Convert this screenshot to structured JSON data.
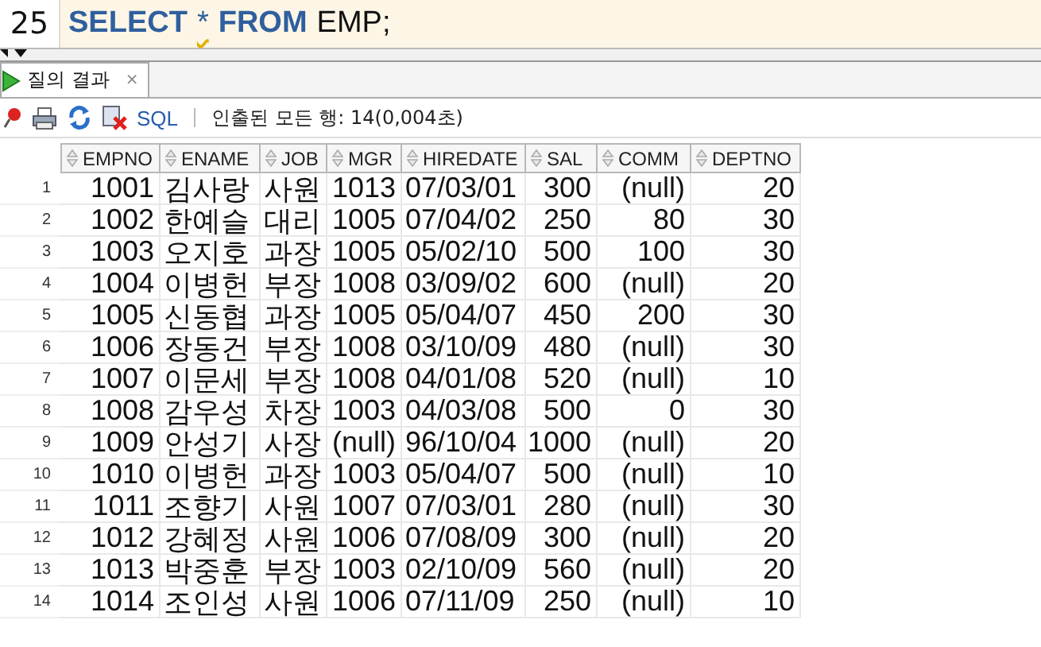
{
  "editor": {
    "line_number": "25",
    "tokens": [
      {
        "text": "SELECT",
        "kind": "keyword"
      },
      {
        "text": "*",
        "kind": "warning"
      },
      {
        "text": "FROM",
        "kind": "keyword"
      },
      {
        "text": "EMP;",
        "kind": "plain"
      }
    ]
  },
  "results_tab": {
    "label": "질의 결과",
    "close": "×",
    "selected": true
  },
  "toolbar": {
    "sql_link": "SQL",
    "status": "인출된 모든 행: 14(0,004초)"
  },
  "table": {
    "columns": [
      "EMPNO",
      "ENAME",
      "JOB",
      "MGR",
      "HIREDATE",
      "SAL",
      "COMM",
      "DEPTNO"
    ],
    "rows": [
      {
        "row_number": "1",
        "cells": [
          "1001",
          "김사랑",
          "사원",
          "1013",
          "07/03/01",
          "300",
          "(null)",
          "20"
        ]
      },
      {
        "row_number": "2",
        "cells": [
          "1002",
          "한예슬",
          "대리",
          "1005",
          "07/04/02",
          "250",
          "80",
          "30"
        ]
      },
      {
        "row_number": "3",
        "cells": [
          "1003",
          "오지호",
          "과장",
          "1005",
          "05/02/10",
          "500",
          "100",
          "30"
        ]
      },
      {
        "row_number": "4",
        "cells": [
          "1004",
          "이병헌",
          "부장",
          "1008",
          "03/09/02",
          "600",
          "(null)",
          "20"
        ]
      },
      {
        "row_number": "5",
        "cells": [
          "1005",
          "신동협",
          "과장",
          "1005",
          "05/04/07",
          "450",
          "200",
          "30"
        ]
      },
      {
        "row_number": "6",
        "cells": [
          "1006",
          "장동건",
          "부장",
          "1008",
          "03/10/09",
          "480",
          "(null)",
          "30"
        ]
      },
      {
        "row_number": "7",
        "cells": [
          "1007",
          "이문세",
          "부장",
          "1008",
          "04/01/08",
          "520",
          "(null)",
          "10"
        ]
      },
      {
        "row_number": "8",
        "cells": [
          "1008",
          "감우성",
          "차장",
          "1003",
          "04/03/08",
          "500",
          "0",
          "30"
        ]
      },
      {
        "row_number": "9",
        "cells": [
          "1009",
          "안성기",
          "사장",
          "(null)",
          "96/10/04",
          "1000",
          "(null)",
          "20"
        ]
      },
      {
        "row_number": "10",
        "cells": [
          "1010",
          "이병헌",
          "과장",
          "1003",
          "05/04/07",
          "500",
          "(null)",
          "10"
        ]
      },
      {
        "row_number": "11",
        "cells": [
          "1011",
          "조향기",
          "사원",
          "1007",
          "07/03/01",
          "280",
          "(null)",
          "30"
        ]
      },
      {
        "row_number": "12",
        "cells": [
          "1012",
          "강혜정",
          "사원",
          "1006",
          "07/08/09",
          "300",
          "(null)",
          "20"
        ]
      },
      {
        "row_number": "13",
        "cells": [
          "1013",
          "박중훈",
          "부장",
          "1003",
          "02/10/09",
          "560",
          "(null)",
          "20"
        ]
      },
      {
        "row_number": "14",
        "cells": [
          "1014",
          "조인성",
          "사원",
          "1006",
          "07/11/09",
          "250",
          "(null)",
          "10"
        ]
      }
    ]
  }
}
